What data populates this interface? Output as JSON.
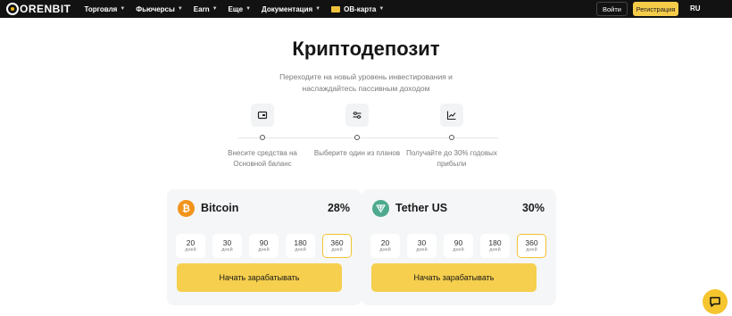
{
  "header": {
    "logo_text": "ORENBIT",
    "nav": [
      {
        "label": "Торговля",
        "has_dropdown": true
      },
      {
        "label": "Фьючерсы",
        "has_dropdown": true
      },
      {
        "label": "Earn",
        "has_dropdown": true
      },
      {
        "label": "Еще",
        "has_dropdown": true
      },
      {
        "label": "Документация",
        "has_dropdown": true
      }
    ],
    "ob_card_label": "OB-карта",
    "login_label": "Войти",
    "register_label": "Регистрация",
    "language": "RU"
  },
  "hero": {
    "title": "Криптодепозит",
    "subtitle_line1": "Переходите на новый уровень инвестирования и",
    "subtitle_line2": "наслаждайтесь пассивным доходом"
  },
  "steps": [
    {
      "icon": "wallet-icon",
      "line1": "Внесите средства на",
      "line2": "Основной баланс"
    },
    {
      "icon": "sliders-icon",
      "line1": "Выберите один из планов",
      "line2": ""
    },
    {
      "icon": "chart-icon",
      "line1": "Получайте до 30% годовых",
      "line2": "прибыли"
    }
  ],
  "cards": [
    {
      "coin": "Bitcoin",
      "apy": "28%",
      "icon": "bitcoin-icon",
      "plans": [
        {
          "days": "20",
          "unit": "дней",
          "selected": false
        },
        {
          "days": "30",
          "unit": "дней",
          "selected": false
        },
        {
          "days": "90",
          "unit": "дней",
          "selected": false
        },
        {
          "days": "180",
          "unit": "дней",
          "selected": false
        },
        {
          "days": "360",
          "unit": "дней",
          "selected": true
        }
      ],
      "button": "Начать зарабатывать"
    },
    {
      "coin": "Tether US",
      "apy": "30%",
      "icon": "tether-icon",
      "plans": [
        {
          "days": "20",
          "unit": "дней",
          "selected": false
        },
        {
          "days": "30",
          "unit": "дней",
          "selected": false
        },
        {
          "days": "90",
          "unit": "дней",
          "selected": false
        },
        {
          "days": "180",
          "unit": "дней",
          "selected": false
        },
        {
          "days": "360",
          "unit": "дней",
          "selected": true
        }
      ],
      "button": "Начать зарабатывать"
    }
  ],
  "colors": {
    "accent": "#f5cf4d",
    "header_bg": "#121212",
    "bitcoin": "#f2931a",
    "tether": "#4eaa8f"
  }
}
